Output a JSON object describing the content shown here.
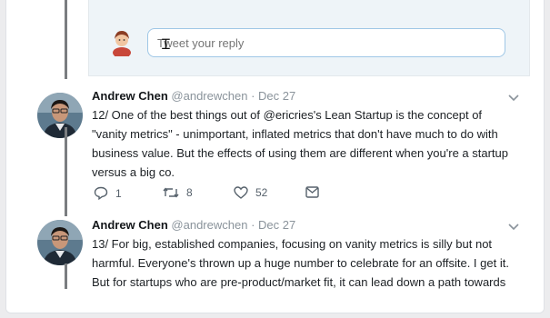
{
  "reply": {
    "placeholder": "Tweet your reply",
    "value": ""
  },
  "tweets": [
    {
      "name": "Andrew Chen",
      "handle": "@andrewchen",
      "separator": "·",
      "date": "Dec 27",
      "lines": [
        "12/ One of the best things out of @ericries's Lean Startup is the concept of",
        "\"vanity metrics\" - unimportant, inflated metrics that don't have much to do with",
        "business value. But the effects of using them are different when you're a startup",
        "versus a big co."
      ],
      "replies": "1",
      "retweets": "8",
      "likes": "52"
    },
    {
      "name": "Andrew Chen",
      "handle": "@andrewchen",
      "separator": "·",
      "date": "Dec 27",
      "lines": [
        "13/ For big, established companies, focusing on vanity metrics is silly but not",
        "harmful. Everyone's thrown up a huge number to celebrate for an offsite. I get it.",
        "But for startups who are pre-product/market fit, it can lead down a path towards"
      ]
    }
  ],
  "icons": {
    "reply": "reply-icon",
    "retweet": "retweet-icon",
    "like": "heart-icon",
    "dm": "envelope-icon",
    "more": "chevron-down-icon"
  },
  "colors": {
    "accent": "#1da1f2",
    "muted": "#8a939b"
  }
}
